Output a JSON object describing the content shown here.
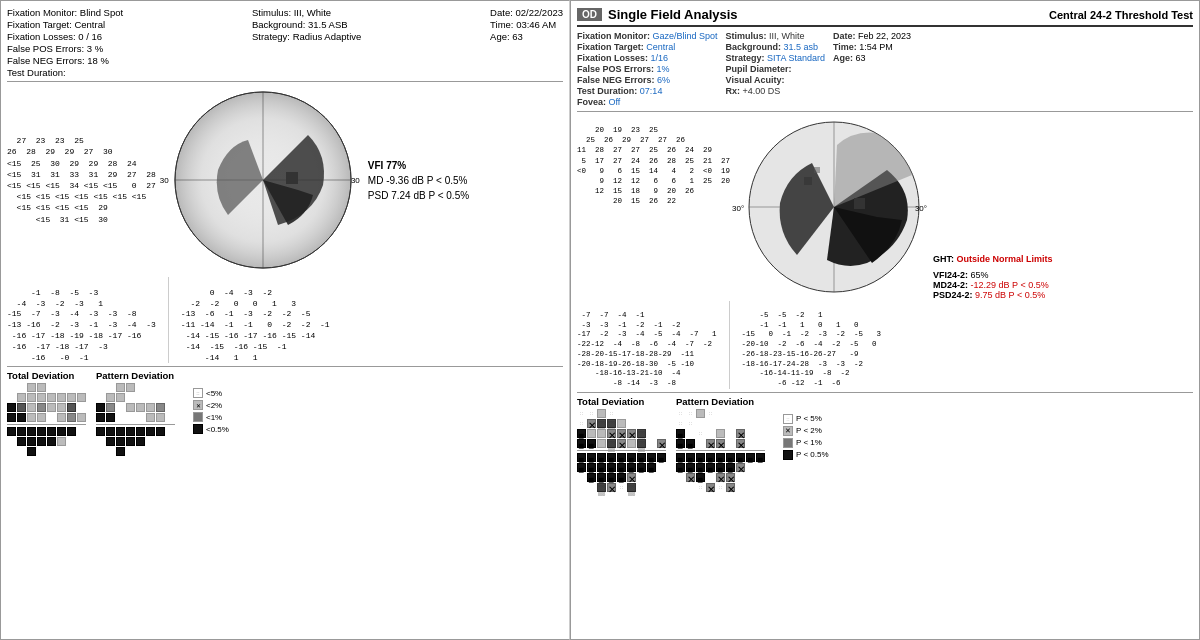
{
  "left": {
    "header": {
      "col1": [
        "Fixation Monitor: Blind Spot",
        "Fixation Target: Central",
        "Fixation Losses: 0 / 16",
        "False POS Errors: 3 %",
        "False NEG Errors: 18 %",
        "Test Duration:"
      ],
      "col2": [
        "Stimulus: III, White",
        "Background: 31.5 ASB",
        "Strategy: Radius Adaptive"
      ],
      "col3": [
        "Date: 02/22/2023",
        "Time: 03:46 AM",
        "Age: 63"
      ]
    },
    "vfi": "VFI  77%",
    "md": "MD  -9.36 dB P < 0.5%",
    "psd": "PSD  7.24 dB P < 0.5%",
    "total_dev_label": "Total Deviation",
    "pattern_dev_label": "Pattern Deviation",
    "threshold_numbers": "  27  23  23  25\n26  28  29  29  27  30\n<15  25  30  29  29  28  24\n<15  31  31  33  31  29  27  28\n30-<15 <15 <15  34  <15 <15   0  27\n    <15 <15 <15 <15  <15 <15  <15\n    <15 <15 <15 <15  29\n        <15  31  <15  30",
    "total_dev_numbers": "     -1  -8  -5  -3\n  -4  -3  -2  -3   1\n-15  -7  -3  -4  -3  -3  -8\n-13 -16  -2  -3  -1  -3  -4  -3\n    -16 -17 -18 -19 -18 -17 -16\n    -16  -17 -18 -17  -3\n        -16   -0  -1",
    "pattern_dev_numbers": "      0  -4  -3  -2\n  -2  -2   0   0   1   3\n-13  -6  -1  -3  -2  -2  -5\n-11 -14  -1  -1   0  -2  -2  -1\n    -14 -15 -16 -17 -16 -15 -14\n    -14  -15  -16 -15  -1\n        -14   1   1"
  },
  "right": {
    "od_badge": "OD",
    "title": "Single Field Analysis",
    "test_type": "Central 24-2 Threshold Test",
    "header": {
      "col1_labels": [
        "Fixation Monitor:",
        "Fixation Target:",
        "Fixation Losses:",
        "False POS Errors:",
        "False NEG Errors:",
        "Test Duration:",
        "Fovea:"
      ],
      "col1_values": [
        "Gaze/Blind Spot",
        "Central",
        "1/16",
        "1%",
        "6%",
        "07:14",
        "Off"
      ],
      "col2_labels": [
        "Stimulus:",
        "Background:",
        "Strategy:",
        "Pupil Diameter:",
        "Visual Acuity:",
        "Rx:"
      ],
      "col2_values": [
        "III, White",
        "31.5 asb",
        "SITA Standard",
        "",
        "",
        "+4.00 DS"
      ],
      "col3_labels": [
        "Date:",
        "Time:",
        "Age:"
      ],
      "col3_values": [
        "Feb 22, 2023",
        "1:54 PM",
        "63"
      ]
    },
    "threshold_numbers": "    20  19  23  25\n  25  26  29  27  27  26\n11  28  27  27  25  26  24  29\n 5  17  27  24  26  28  25  21  27\n<0   9   6  15  14   4   2  <0  19\n     9  12  12   6   6   1  25  20\n    12  15  18   9  20  26\n        20  15  26  22",
    "total_dev_numbers": "  -7  -7  -4  -1\n  -3  -3  -1  -2  -1  -2\n-17  -2  -3  -4  -5  -4  -7   1\n-22-12  -4  -8  -6  -4  -7  -2\n-28-20-15-17-18-28-29  -11\n-20-18-19-26-18-30  -5 -10\n    -18-16-13-21-10  -4\n        -8 -14  -3  -8",
    "pattern_dev_numbers": "     -5  -5  -2   1\n    -1  -1   1   0   1   0\n-15   0  -1  -2  -3  -2  -5   3\n-20-10  -2  -6  -4  -2  -5   0\n-26-18-23-15-16-26-27   -9\n-18-16-17-24-28-3  -3   -2\n    -16-14-11-19  -8  -2\n        -6 -12  -1  -6",
    "ght_label": "GHT:",
    "ght_value": "Outside Normal Limits",
    "vfi_label": "VFI24-2:",
    "vfi_value": "65%",
    "md_label": "MD24-2:",
    "md_value": "-12.29 dB P < 0.5%",
    "psd_label": "PSD24-2:",
    "psd_value": "9.75 dB P < 0.5%",
    "total_dev_label": "Total Deviation",
    "pattern_dev_label": "Pattern Deviation",
    "legend": {
      "items": [
        {
          "symbol": "::",
          "label": "P < 5%"
        },
        {
          "symbol": "✕",
          "label": "P < 2%"
        },
        {
          "symbol": "▒",
          "label": "P < 1%"
        },
        {
          "symbol": "■",
          "label": "P < 0.5%"
        }
      ]
    }
  }
}
